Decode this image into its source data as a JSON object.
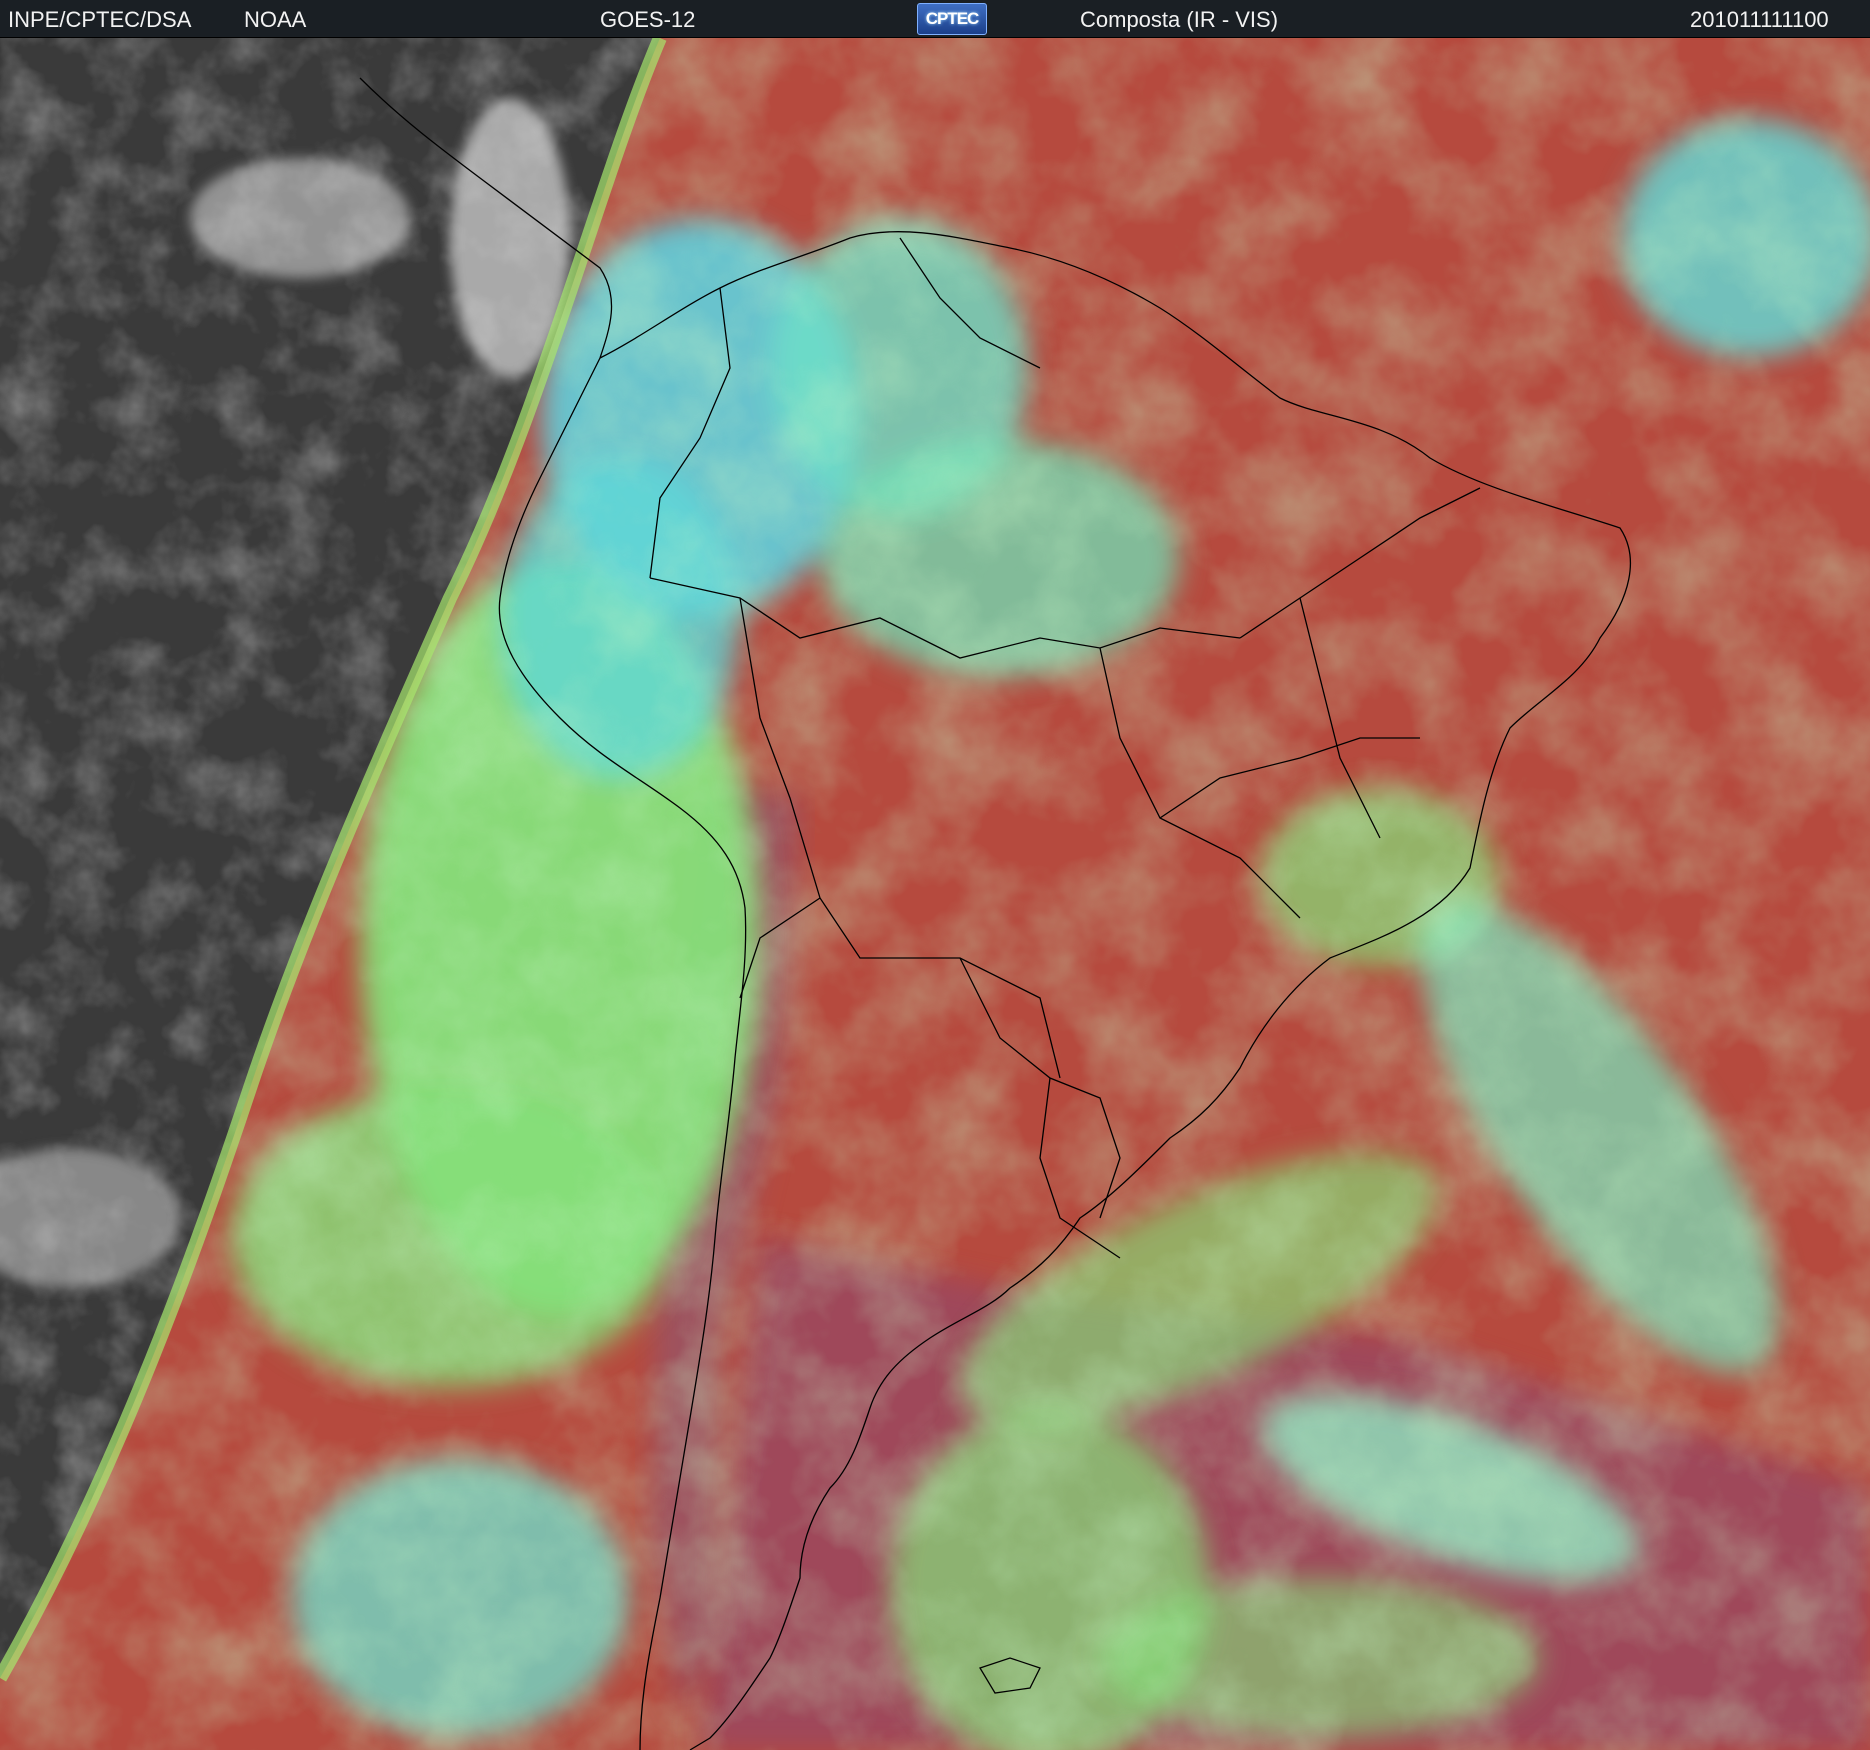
{
  "header": {
    "source": "INPE/CPTEC/DSA",
    "agency": "NOAA",
    "satellite": "GOES-12",
    "logo_text": "CPTEC",
    "product": "Composta (IR - VIS)",
    "timestamp": "201011111100"
  },
  "colors": {
    "ir_night_background": "#3a3a3a",
    "clear_land_ocean": "#b64a3e",
    "low_cloud": "#86e07a",
    "high_cloud": "#5ce8e6",
    "coastline": "#000000",
    "header_bg": "#1a1f24"
  }
}
